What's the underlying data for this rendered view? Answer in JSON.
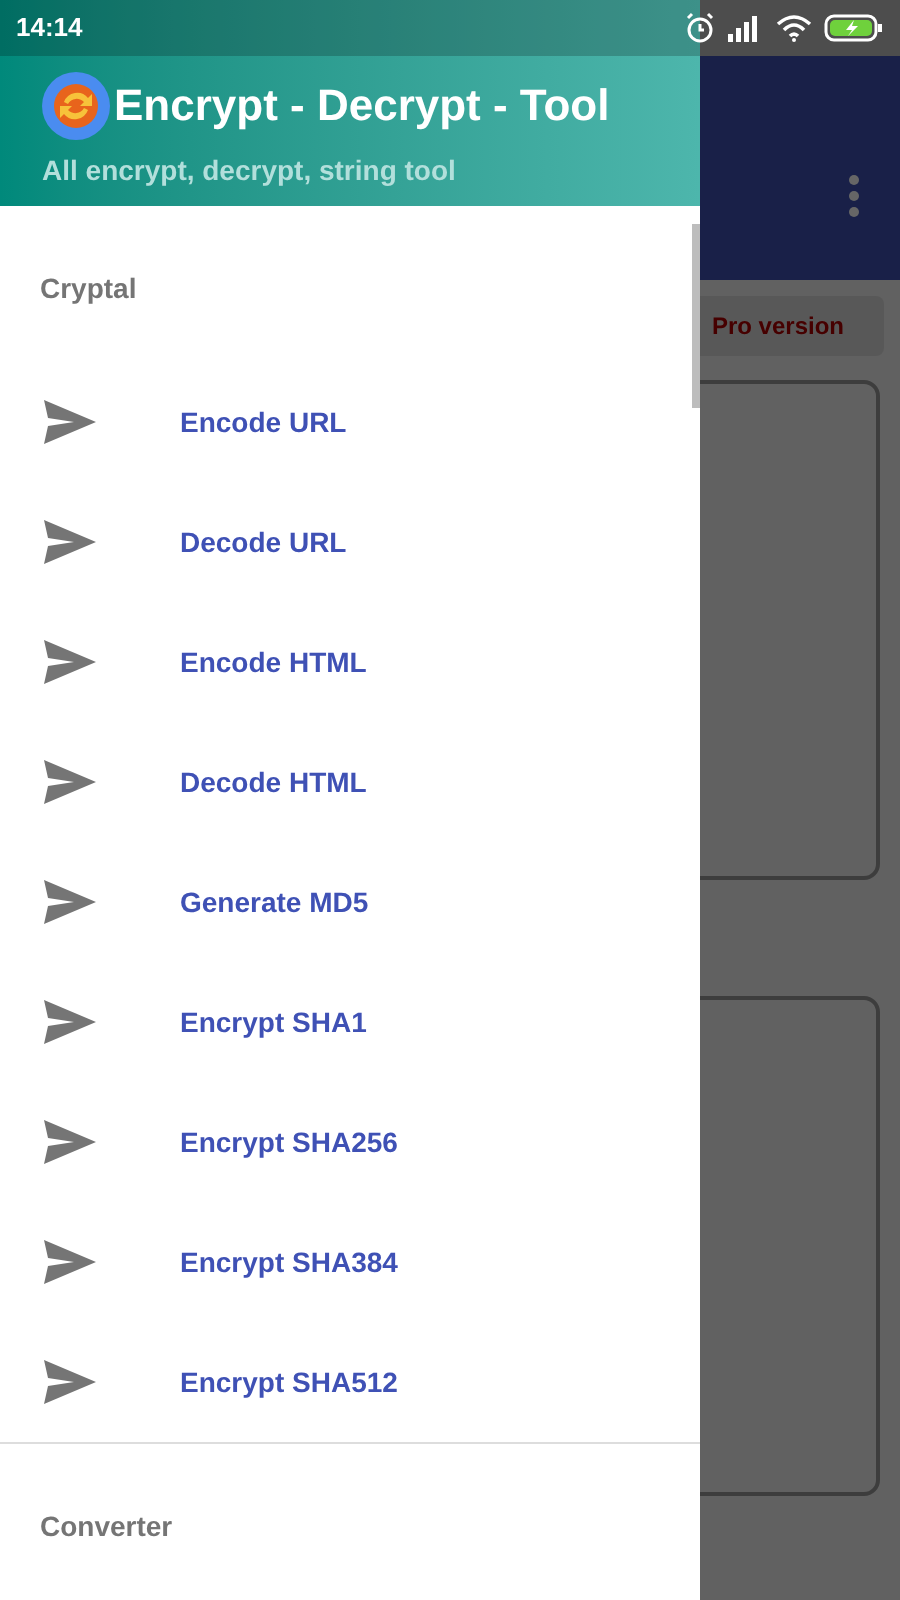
{
  "status_bar": {
    "time": "14:14"
  },
  "app": {
    "pro_button": "Pro version"
  },
  "drawer": {
    "title": "Encrypt - Decrypt - Tool",
    "subtitle": "All encrypt, decrypt, string tool",
    "sections": [
      {
        "title": "Cryptal",
        "items": [
          {
            "label": "Encode URL"
          },
          {
            "label": "Decode URL"
          },
          {
            "label": "Encode HTML"
          },
          {
            "label": "Decode HTML"
          },
          {
            "label": "Generate MD5"
          },
          {
            "label": "Encrypt SHA1"
          },
          {
            "label": "Encrypt SHA256"
          },
          {
            "label": "Encrypt SHA384"
          },
          {
            "label": "Encrypt SHA512"
          }
        ]
      },
      {
        "title": "Converter"
      }
    ]
  }
}
